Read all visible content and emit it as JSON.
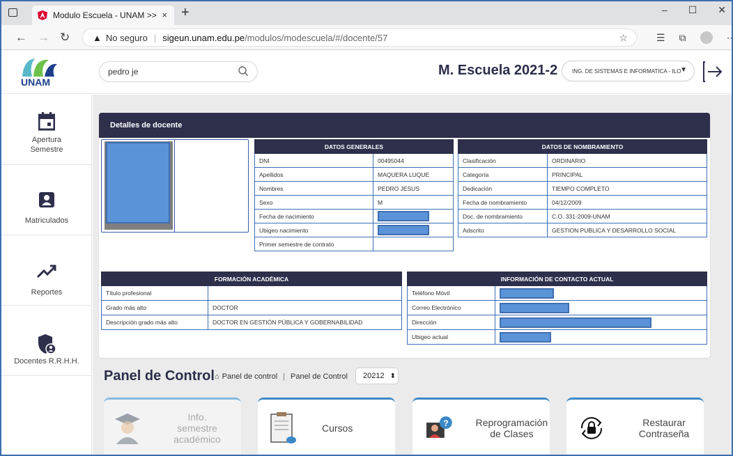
{
  "browser": {
    "tab_title": "Modulo Escuela - UNAM >>",
    "tab_close": "×",
    "new_tab": "+",
    "security_label": "No seguro",
    "url_host": "sigeun.unam.edu.pe",
    "url_path": "/modulos/modescuela/#/docente/57",
    "win_minimize": "–",
    "win_maximize": "☐",
    "win_close": "✕"
  },
  "header": {
    "logo_text": "UNAM",
    "search_value": "pedro je",
    "title": "M. Escuela 2021-2",
    "career_select": "ING. DE SISTEMAS E INFORMATICA - ILO"
  },
  "sidebar": {
    "items": [
      {
        "label": "Apertura Semestre",
        "icon": "calendar-icon"
      },
      {
        "label": "Matriculados",
        "icon": "person-badge-icon"
      },
      {
        "label": "Reportes",
        "icon": "trend-up-icon"
      },
      {
        "label": "Docentes R.R.H.H.",
        "icon": "shield-user-icon"
      }
    ]
  },
  "detalle": {
    "title": "Detalles de docente",
    "generales": {
      "heading": "DATOS GENERALES",
      "rows": [
        {
          "label": "DNI",
          "value": "00495044"
        },
        {
          "label": "Apellidos",
          "value": "MAQUERA LUQUE"
        },
        {
          "label": "Nombres",
          "value": "PEDRO JESUS"
        },
        {
          "label": "Sexo",
          "value": "M"
        },
        {
          "label": "Fecha de nacimiento",
          "value": ""
        },
        {
          "label": "Ubigeo nacimiento",
          "value": ""
        },
        {
          "label": "Primer semestre de contrato",
          "value": ""
        }
      ]
    },
    "nombramiento": {
      "heading": "DATOS DE NOMBRAMIENTO",
      "rows": [
        {
          "label": "Clasificación",
          "value": "ORDINARIO"
        },
        {
          "label": "Categoría",
          "value": "PRINCIPAL"
        },
        {
          "label": "Dedicación",
          "value": "TIEMPO COMPLETO"
        },
        {
          "label": "Fecha de nombramiento",
          "value": "04/12/2009"
        },
        {
          "label": "Doc. de nombramiento",
          "value": "C.O. 331-2009-UNAM"
        },
        {
          "label": "Adscrito",
          "value": "GESTION PUBLICA Y DESARROLLO SOCIAL"
        }
      ]
    },
    "formacion": {
      "heading": "FORMACIÓN ACADÉMICA",
      "rows": [
        {
          "label": "Título profesional",
          "value": ""
        },
        {
          "label": "Grado más alto",
          "value": "DOCTOR"
        },
        {
          "label": "Descripción grado más alto",
          "value": "DOCTOR EN GESTIÓN PÚBLICA Y GOBERNABILIDAD"
        }
      ]
    },
    "contacto": {
      "heading": "INFORMACIÓN DE CONTACTO ACTUAL",
      "rows": [
        {
          "label": "Teléfono Móvil",
          "value": ""
        },
        {
          "label": "Correo Electrónico",
          "value": ""
        },
        {
          "label": "Dirección",
          "value": ""
        },
        {
          "label": "Ubigeo actual",
          "value": ""
        }
      ]
    }
  },
  "panel": {
    "title": "Panel de Control",
    "breadcrumb_1": "Panel de control",
    "breadcrumb_2": "Panel de Control",
    "semester": "20212",
    "tiles": [
      {
        "label_1": "Info.",
        "label_2": "semestre",
        "label_3": "académico",
        "icon": "graduate-icon"
      },
      {
        "label_1": "Cursos",
        "icon": "clipboard-cloud-icon"
      },
      {
        "label_1": "Reprogramación",
        "label_2": "de Clases",
        "icon": "teacher-help-icon"
      },
      {
        "label_1": "Restaurar",
        "label_2": "Contraseña",
        "icon": "lock-refresh-icon"
      }
    ]
  }
}
